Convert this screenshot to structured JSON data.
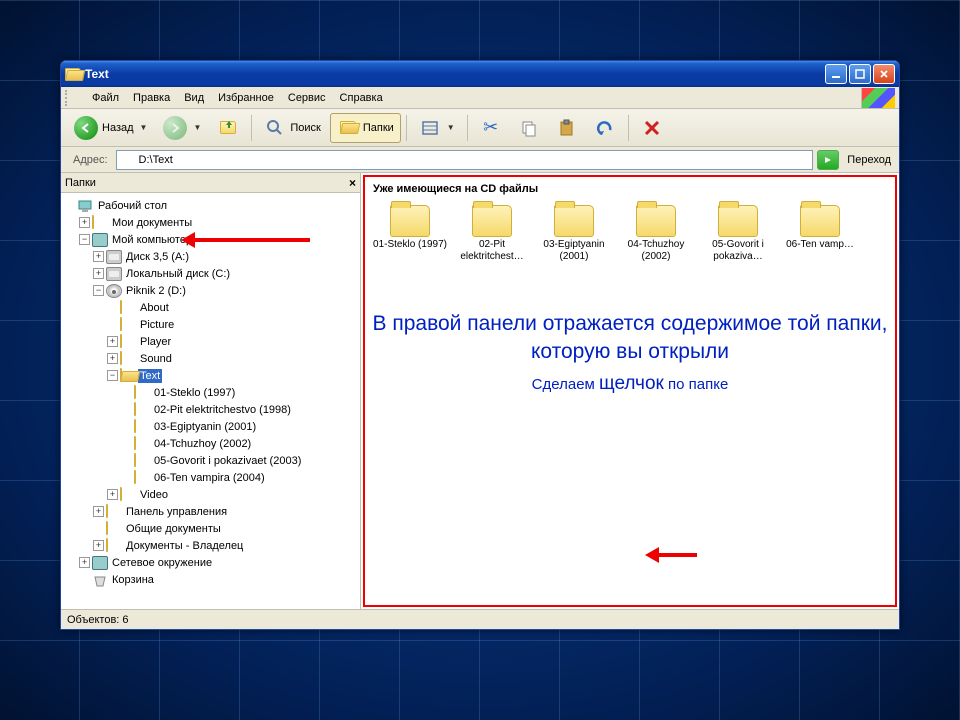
{
  "window": {
    "title": "Text"
  },
  "menubar": {
    "items": [
      "Файл",
      "Правка",
      "Вид",
      "Избранное",
      "Сервис",
      "Справка"
    ]
  },
  "toolbar": {
    "back": "Назад",
    "search": "Поиск",
    "folders": "Папки"
  },
  "addressbar": {
    "label": "Адрес:",
    "value": "D:\\Text",
    "go": "Переход"
  },
  "sidebar": {
    "title": "Папки",
    "tree": {
      "desktop": "Рабочий стол",
      "mydocs": "Мои документы",
      "mycomp": "Мой компьютер",
      "floppy": "Диск 3,5 (A:)",
      "localc": "Локальный диск (C:)",
      "piknik": "Piknik 2 (D:)",
      "about": "About",
      "picture": "Picture",
      "player": "Player",
      "sound": "Sound",
      "text": "Text",
      "t1": "01-Steklo (1997)",
      "t2": "02-Pit elektritchestvo (1998)",
      "t3": "03-Egiptyanin (2001)",
      "t4": "04-Tchuzhoy (2002)",
      "t5": "05-Govorit i pokazivaet (2003)",
      "t6": "06-Ten vampira (2004)",
      "video": "Video",
      "cpl": "Панель управления",
      "shared": "Общие документы",
      "ownerdocs": "Документы - Владелец",
      "network": "Сетевое окружение",
      "recycle": "Корзина"
    }
  },
  "main": {
    "header": "Уже имеющиеся на CD файлы",
    "items": [
      "01-Steklo (1997)",
      "02-Pit elektritchest…",
      "03-Egiptyanin (2001)",
      "04-Tchuzhoy (2002)",
      "05-Govorit i pokaziva…",
      "06-Ten vamp…"
    ],
    "annot_line1": "В правой панели отражается содержимое той папки, которую вы открыли",
    "annot_line2_a": "Сделаем ",
    "annot_line2_b": "щелчок",
    "annot_line2_c": " по папке"
  },
  "status": {
    "objects": "Объектов: 6"
  }
}
